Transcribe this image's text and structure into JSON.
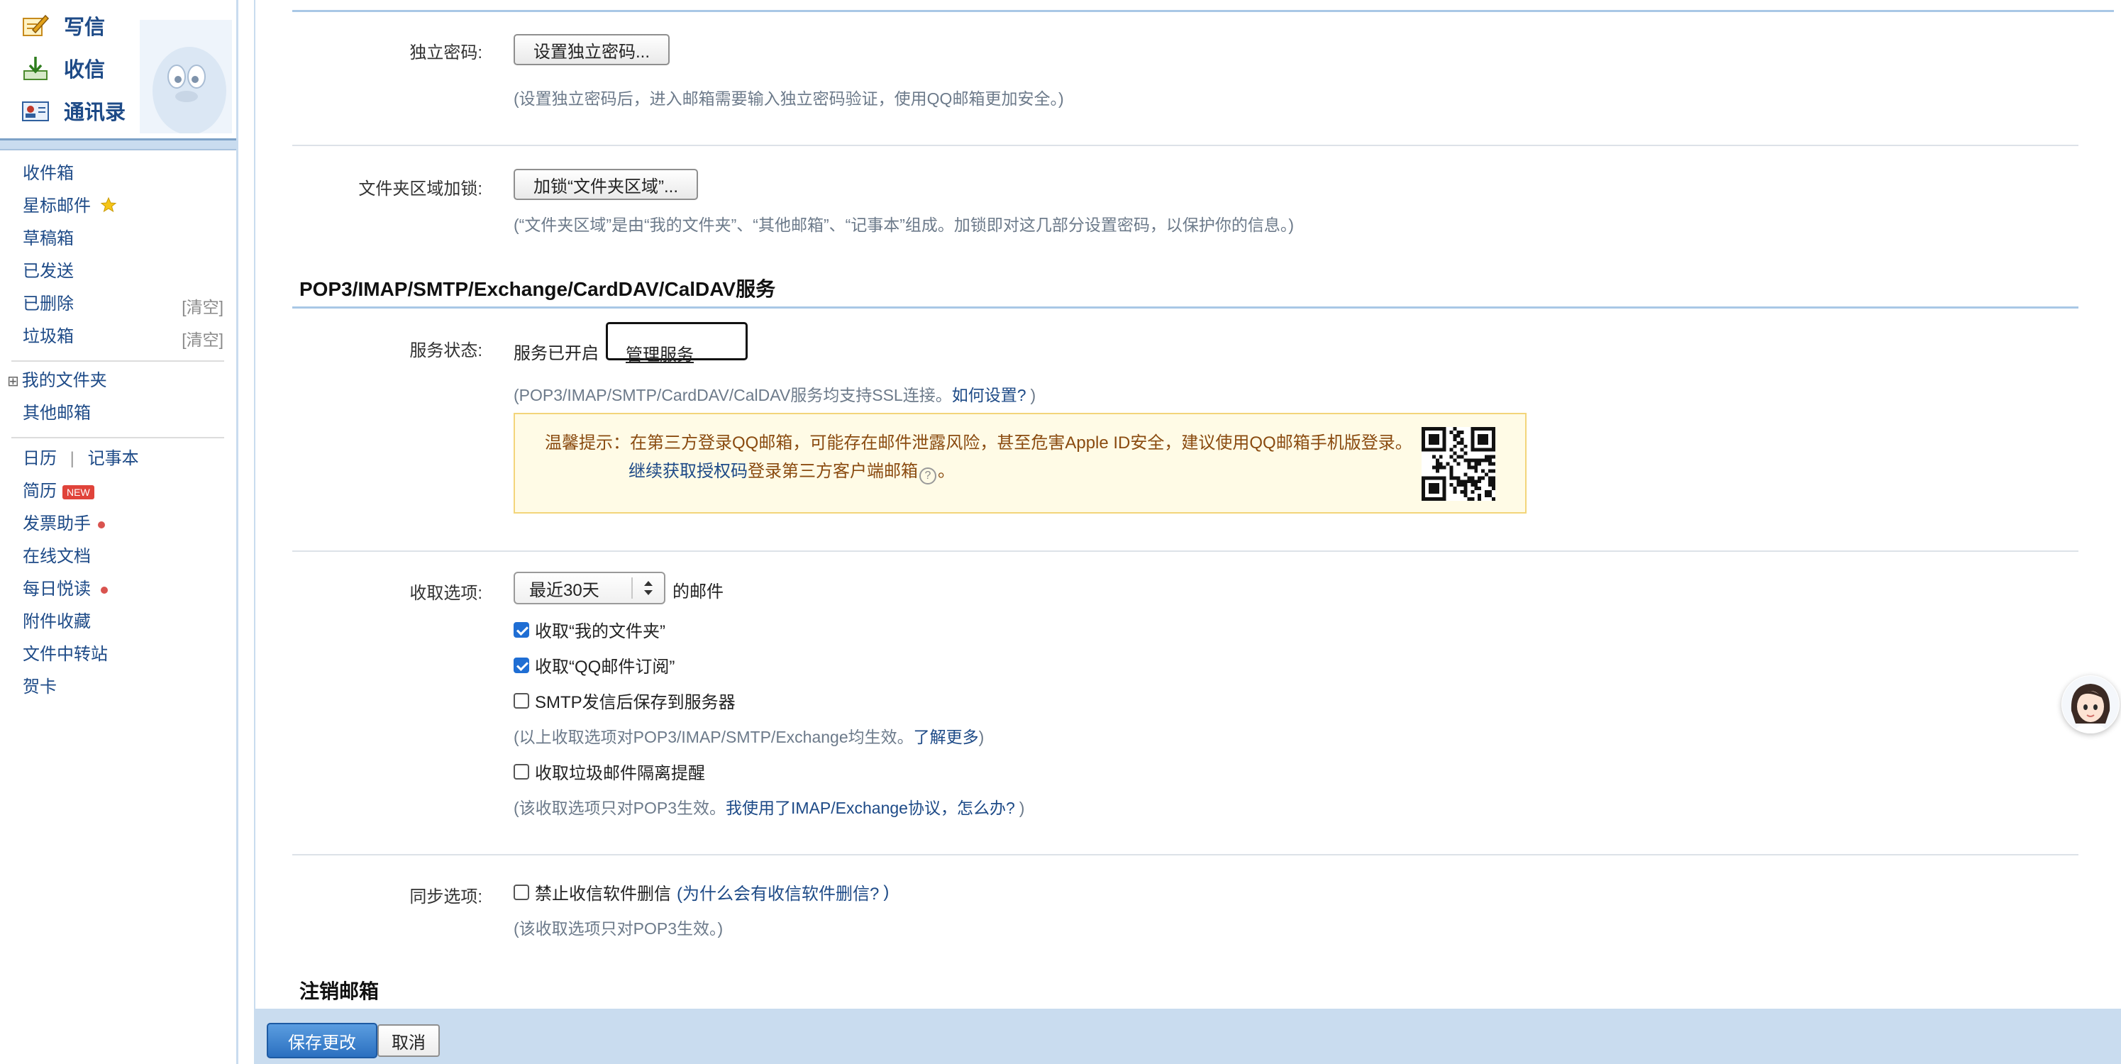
{
  "sidebar": {
    "top_links": {
      "compose": "写信",
      "inbox": "收信",
      "contacts": "通讯录"
    },
    "items": {
      "inbox": "收件箱",
      "starred": "星标邮件",
      "drafts": "草稿箱",
      "sent": "已发送",
      "deleted": "已删除",
      "spam": "垃圾箱",
      "my_folders": "我的文件夹",
      "other_mailbox": "其他邮箱",
      "calendar": "日历",
      "pipe": "|",
      "notebook": "记事本",
      "resume": "简历",
      "invoice": "发票助手",
      "online_docs": "在线文档",
      "daily_read": "每日悦读",
      "attachments": "附件收藏",
      "transfer": "文件中转站",
      "cards": "贺卡"
    },
    "clear_label": "[清空]",
    "new_badge": "NEW",
    "expand_mark": "⊞"
  },
  "settings": {
    "password": {
      "label": "独立密码:",
      "button": "设置独立密码...",
      "hint": "(设置独立密码后，进入邮箱需要输入独立密码验证，使用QQ邮箱更加安全。)"
    },
    "folder_lock": {
      "label": "文件夹区域加锁:",
      "button": "加锁“文件夹区域”...",
      "hint": "(“文件夹区域”是由“我的文件夹”、“其他邮箱”、“记事本”组成。加锁即对这几部分设置密码，以保护你的信息。)"
    },
    "pop3_section": {
      "title": "POP3/IMAP/SMTP/Exchange/CardDAV/CalDAV服务",
      "status_label": "服务状态:",
      "status_value": "服务已开启",
      "manage_link": "管理服务",
      "ssl_hint": "(POP3/IMAP/SMTP/CardDAV/CalDAV服务均支持SSL连接。",
      "how_link": "如何设置?",
      "ssl_hint_end": ")",
      "notice_line1": "温馨提示：在第三方登录QQ邮箱，可能存在邮件泄露风险，甚至危害Apple ID安全，建议使用QQ邮箱手机版登录。",
      "notice_link": "继续获取授权码",
      "notice_line2": "登录第三方客户端邮箱",
      "notice_help": "?",
      "notice_end": "。"
    },
    "receive": {
      "label": "收取选项:",
      "select_value": "最近30天",
      "select_suffix": "的邮件",
      "options": [
        {
          "text": "收取“我的文件夹”",
          "checked": true
        },
        {
          "text": "收取“QQ邮件订阅”",
          "checked": true
        },
        {
          "text": "SMTP发信后保存到服务器",
          "checked": false
        }
      ],
      "hint1": "(以上收取选项对POP3/IMAP/SMTP/Exchange均生效。",
      "learn_more": "了解更多",
      "hint1_end": ")",
      "spam_option": {
        "text": "收取垃圾邮件隔离提醒",
        "checked": false
      },
      "hint2": "(该收取选项只对POP3生效。",
      "imap_link": "我使用了IMAP/Exchange协议，怎么办?",
      "hint2_end": ")"
    },
    "sync": {
      "label": "同步选项:",
      "option": {
        "text": "禁止收信软件删信",
        "checked": false
      },
      "why_link": "(为什么会有收信软件删信?",
      "why_end": ")",
      "hint": "(该收取选项只对POP3生效。)"
    },
    "cancel_account_title": "注销邮箱"
  },
  "footer": {
    "save": "保存更改",
    "cancel": "取消"
  },
  "colors": {
    "link": "#1d4a87",
    "sidebar_bg": "#c9dcef",
    "save_button": "#2b70c0",
    "notice_bg": "#fffbe6"
  }
}
